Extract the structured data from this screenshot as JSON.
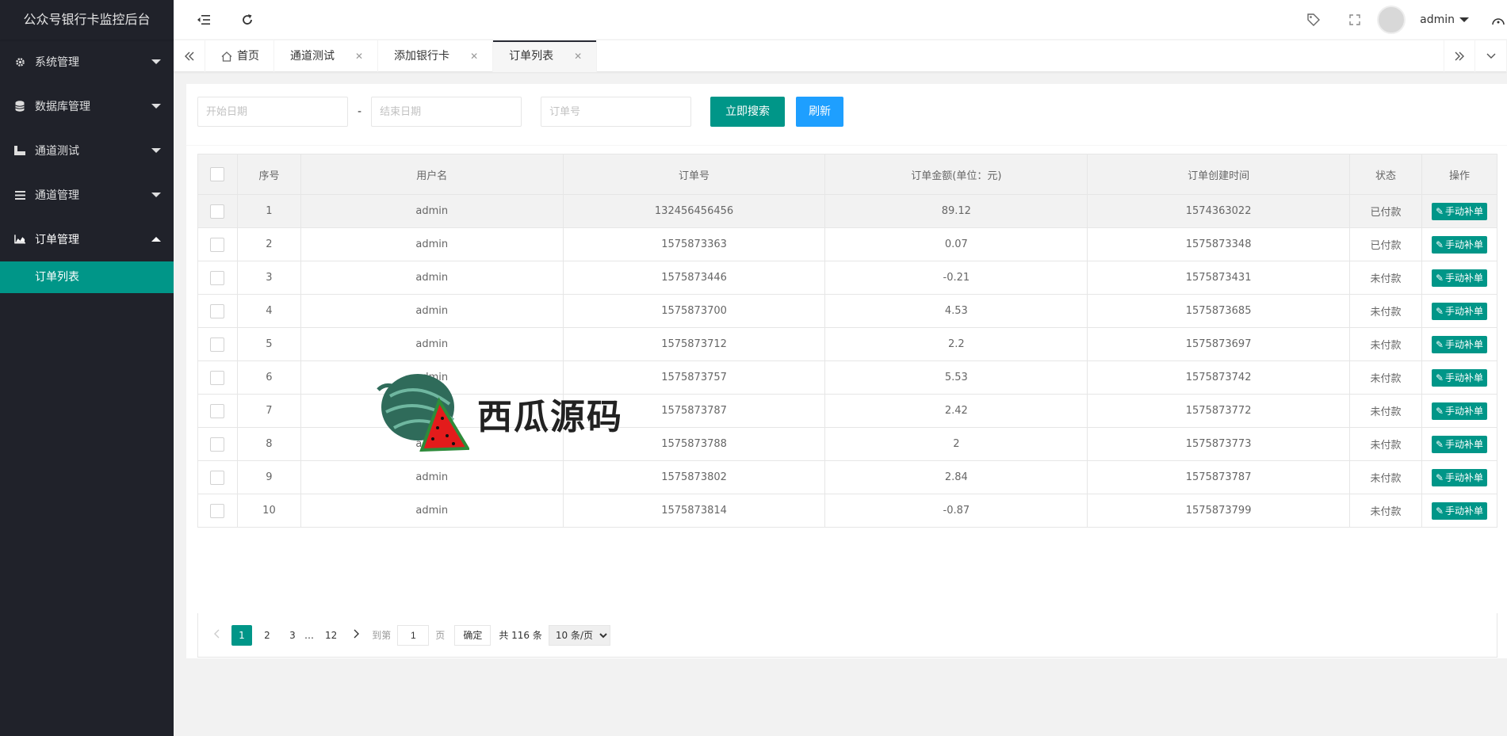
{
  "app": {
    "title": "公众号银行卡监控后台"
  },
  "sidebar": {
    "items": [
      {
        "label": "系统管理",
        "icon": "gear-icon"
      },
      {
        "label": "数据库管理",
        "icon": "database-icon"
      },
      {
        "label": "通道测试",
        "icon": "flask-icon"
      },
      {
        "label": "通道管理",
        "icon": "list-icon"
      },
      {
        "label": "订单管理",
        "icon": "chart-area-icon"
      }
    ],
    "sub_items": [
      {
        "label": "订单列表"
      }
    ]
  },
  "header": {
    "user": "admin"
  },
  "tabs": [
    {
      "label": "首页"
    },
    {
      "label": "通道测试"
    },
    {
      "label": "添加银行卡"
    },
    {
      "label": "订单列表"
    }
  ],
  "search": {
    "start_placeholder": "开始日期",
    "dash": "-",
    "end_placeholder": "结束日期",
    "order_placeholder": "订单号",
    "search_button": "立即搜索",
    "refresh_button": "刷新"
  },
  "table": {
    "headers": [
      "序号",
      "用户名",
      "订单号",
      "订单金额(单位：元)",
      "订单创建时间",
      "状态",
      "操作"
    ],
    "action_label": "手动补单",
    "rows": [
      {
        "no": "1",
        "user": "admin",
        "order": "132456456456",
        "amount": "89.12",
        "created": "1574363022",
        "status": "已付款"
      },
      {
        "no": "2",
        "user": "admin",
        "order": "1575873363",
        "amount": "0.07",
        "created": "1575873348",
        "status": "已付款"
      },
      {
        "no": "3",
        "user": "admin",
        "order": "1575873446",
        "amount": "-0.21",
        "created": "1575873431",
        "status": "未付款"
      },
      {
        "no": "4",
        "user": "admin",
        "order": "1575873700",
        "amount": "4.53",
        "created": "1575873685",
        "status": "未付款"
      },
      {
        "no": "5",
        "user": "admin",
        "order": "1575873712",
        "amount": "2.2",
        "created": "1575873697",
        "status": "未付款"
      },
      {
        "no": "6",
        "user": "admin",
        "order": "1575873757",
        "amount": "5.53",
        "created": "1575873742",
        "status": "未付款"
      },
      {
        "no": "7",
        "user": "admin",
        "order": "1575873787",
        "amount": "2.42",
        "created": "1575873772",
        "status": "未付款"
      },
      {
        "no": "8",
        "user": "admin",
        "order": "1575873788",
        "amount": "2",
        "created": "1575873773",
        "status": "未付款"
      },
      {
        "no": "9",
        "user": "admin",
        "order": "1575873802",
        "amount": "2.84",
        "created": "1575873787",
        "status": "未付款"
      },
      {
        "no": "10",
        "user": "admin",
        "order": "1575873814",
        "amount": "-0.87",
        "created": "1575873799",
        "status": "未付款"
      }
    ]
  },
  "pager": {
    "pages": [
      "1",
      "2",
      "3",
      "…",
      "12"
    ],
    "goto_label": "到第",
    "goto_value": "1",
    "page_unit": "页",
    "confirm": "确定",
    "total": "共 116 条",
    "limit": "10 条/页"
  },
  "watermark": {
    "text": "西瓜源码"
  },
  "colors": {
    "primary": "#009688",
    "blue": "#1e9fff",
    "sidebar": "#20222a"
  }
}
